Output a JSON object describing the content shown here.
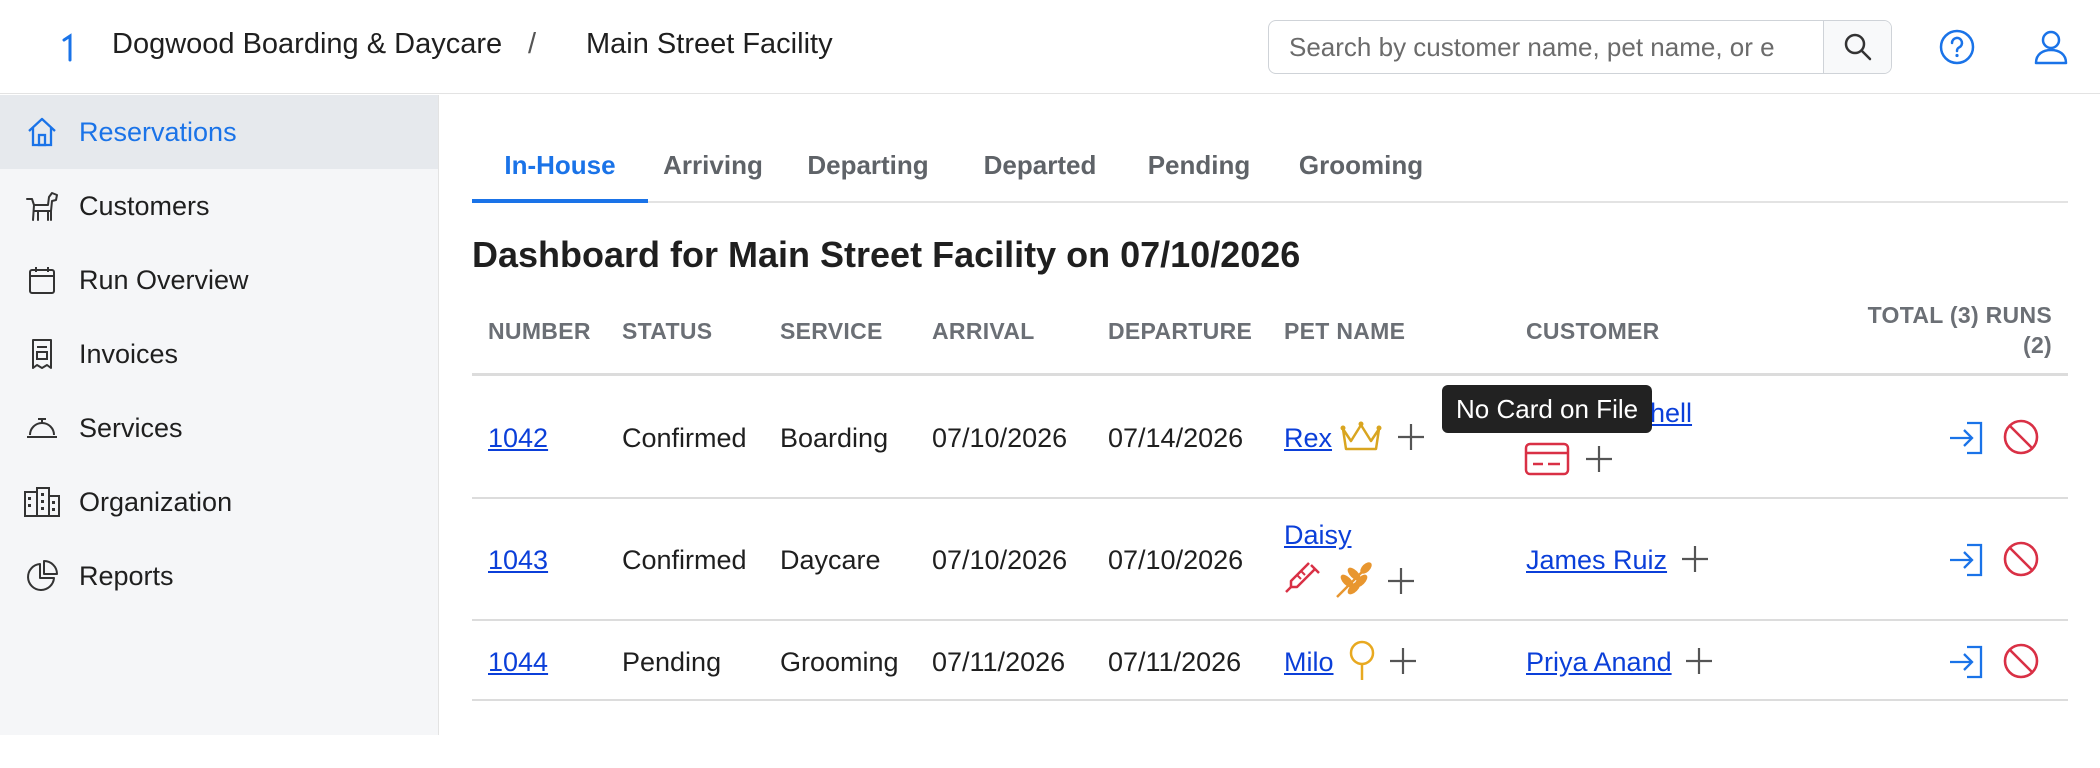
{
  "header": {
    "org_name": "Dogwood Boarding & Daycare",
    "separator": "/",
    "facility": "Main Street Facility",
    "search_placeholder": "Search by customer name, pet name, or e",
    "icons": [
      "logo-icon",
      "search-icon",
      "help-icon",
      "user-icon"
    ]
  },
  "sidebar": {
    "items": [
      {
        "label": "Reservations",
        "icon": "home-icon",
        "active": true
      },
      {
        "label": "Customers",
        "icon": "dog-icon"
      },
      {
        "label": "Run Overview",
        "icon": "calendar-icon"
      },
      {
        "label": "Invoices",
        "icon": "invoice-icon"
      },
      {
        "label": "Services",
        "icon": "bell-icon"
      },
      {
        "label": "Organization",
        "icon": "building-icon"
      },
      {
        "label": "Reports",
        "icon": "pie-chart-icon"
      }
    ]
  },
  "tabs": [
    {
      "label": "In-House",
      "active": true
    },
    {
      "label": "Arriving"
    },
    {
      "label": "Departing"
    },
    {
      "label": "Departed"
    },
    {
      "label": "Pending"
    },
    {
      "label": "Grooming"
    }
  ],
  "page_title": "Dashboard for Main Street Facility on 07/10/2026",
  "table": {
    "headers": {
      "number": "NUMBER",
      "status": "STATUS",
      "service": "SERVICE",
      "arrival": "ARRIVAL",
      "departure": "DEPARTURE",
      "pet_name": "PET NAME",
      "customer": "CUSTOMER",
      "total_line1": "TOTAL (3) RUNS",
      "total_line2": "(2)"
    },
    "rows": [
      {
        "number": "1042",
        "status": "Confirmed",
        "service": "Boarding",
        "arrival": "07/10/2026",
        "departure": "07/14/2026",
        "pet": "Rex",
        "pet_icons": [
          "crown-icon"
        ],
        "customer": "hell",
        "customer_icons": [
          "credit-card-alert-icon"
        ]
      },
      {
        "number": "1043",
        "status": "Confirmed",
        "service": "Daycare",
        "arrival": "07/10/2026",
        "departure": "07/10/2026",
        "pet": "Daisy",
        "pet_icons": [
          "syringe-icon",
          "wheat-icon"
        ],
        "customer": "James Ruiz"
      },
      {
        "number": "1044",
        "status": "Pending",
        "service": "Grooming",
        "arrival": "07/11/2026",
        "departure": "07/11/2026",
        "pet": "Milo",
        "pet_icons": [
          "pin-icon"
        ],
        "customer": "Priya Anand"
      }
    ]
  },
  "tooltip": "No Card on File",
  "colors": {
    "accent": "#1a73e8",
    "danger": "#d93045",
    "gold": "#d9a520",
    "orange": "#e8962f",
    "link": "#0b3fd9"
  }
}
